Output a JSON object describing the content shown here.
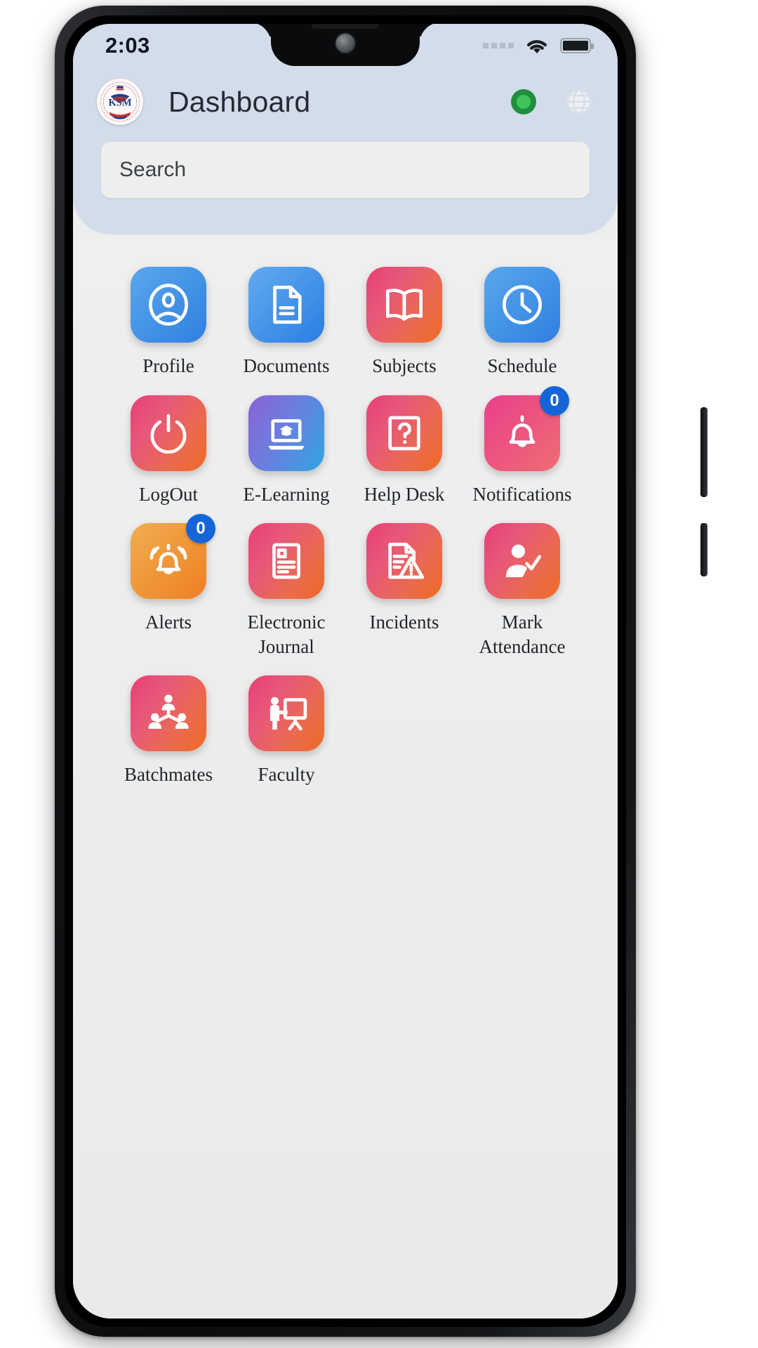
{
  "status_bar": {
    "time": "2:03",
    "signal_icon": "signal-dots-icon",
    "wifi_icon": "wifi-icon",
    "battery_icon": "battery-full-icon"
  },
  "header": {
    "logo_name": "school-crest-logo",
    "logo_text": "KSM",
    "title": "Dashboard",
    "status_indicator_name": "online-status-dot",
    "status_indicator_color": "#2aa745",
    "language_icon": "globe-icon"
  },
  "search": {
    "placeholder": "Search",
    "value": ""
  },
  "grid": {
    "items": [
      {
        "label": "Profile",
        "icon": "user-circle-icon",
        "style": "g-blue",
        "badge": null
      },
      {
        "label": "Documents",
        "icon": "document-icon",
        "style": "g-blue2",
        "badge": null
      },
      {
        "label": "Subjects",
        "icon": "open-book-icon",
        "style": "g-pinkorange",
        "badge": null
      },
      {
        "label": "Schedule",
        "icon": "clock-icon",
        "style": "g-blue",
        "badge": null
      },
      {
        "label": "LogOut",
        "icon": "power-icon",
        "style": "g-pinkorange",
        "badge": null
      },
      {
        "label": "E-Learning",
        "icon": "laptop-graduation-icon",
        "style": "g-purpleblue",
        "badge": null
      },
      {
        "label": "Help Desk",
        "icon": "question-square-icon",
        "style": "g-pinkorange",
        "badge": null
      },
      {
        "label": "Notifications",
        "icon": "bell-icon",
        "style": "g-pink",
        "badge": "0"
      },
      {
        "label": "Alerts",
        "icon": "bell-ringing-icon",
        "style": "g-orange",
        "badge": "0"
      },
      {
        "label": "Electronic Journal",
        "icon": "journal-icon",
        "style": "g-pinkorange",
        "badge": null
      },
      {
        "label": "Incidents",
        "icon": "document-warning-icon",
        "style": "g-pinkorange",
        "badge": null
      },
      {
        "label": "Mark Attendance",
        "icon": "person-check-icon",
        "style": "g-pinkorange",
        "badge": null
      },
      {
        "label": "Batchmates",
        "icon": "people-network-icon",
        "style": "g-pinkorange",
        "badge": null
      },
      {
        "label": "Faculty",
        "icon": "teacher-board-icon",
        "style": "g-pinkorange",
        "badge": null
      }
    ]
  },
  "colors": {
    "header_bg": "#d2dcea",
    "body_bg": "#ececec",
    "badge": "#1565d8",
    "accent_pink": "#e83f76",
    "accent_orange": "#ef6a22",
    "accent_blue": "#2f7fe0"
  }
}
